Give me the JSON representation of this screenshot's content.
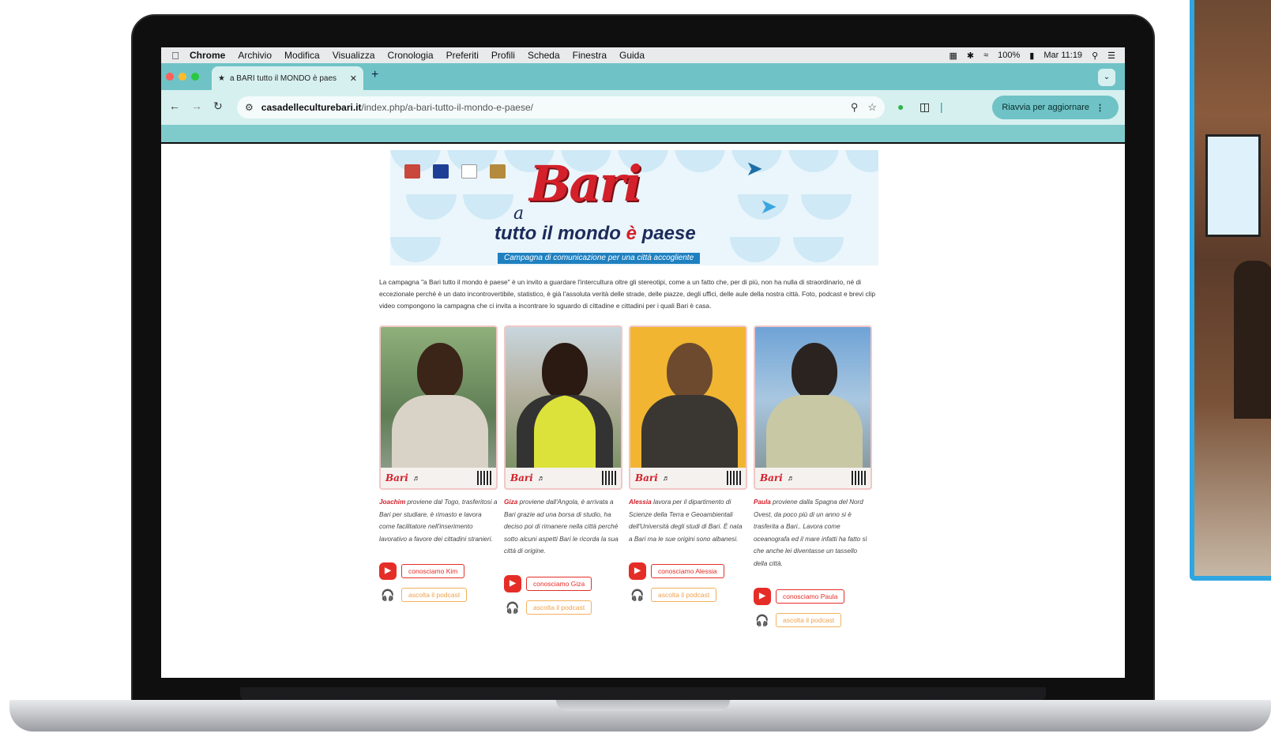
{
  "menubar": {
    "items": [
      "Chrome",
      "Archivio",
      "Modifica",
      "Visualizza",
      "Cronologia",
      "Preferiti",
      "Profili",
      "Scheda",
      "Finestra",
      "Guida"
    ],
    "battery": "100%",
    "clock": "Mar 11:19"
  },
  "browser": {
    "tab_title": "a BARI tutto il MONDO è paes",
    "url_host": "casadelleculturebari.it",
    "url_path": "/index.php/a-bari-tutto-il-mondo-e-paese/",
    "relaunch_label": "Riavvia per aggiornare"
  },
  "banner": {
    "a": "a",
    "bari": "Bari",
    "subtitle_pre": "tutto il mondo ",
    "subtitle_e": "è",
    "subtitle_post": " paese",
    "stripe": "Campagna di comunicazione per una città accogliente"
  },
  "intro": "La campagna \"a Bari tutto il mondo è paese\" è un invito a guardare l'intercultura oltre gli stereotipi, come a un fatto che, per di più, non ha nulla di straordinario, né di eccezionale perché è un dato incontrovertibile, statistico, è già l'assoluta verità delle strade, delle piazze, degli uffici, delle aule della nostra città. Foto, podcast e brevi clip video compongono la campagna che ci invita a incontrare lo sguardo di cittadine e cittadini per i quali Bari è casa.",
  "cards": [
    {
      "name": "Joachim",
      "text": " proviene dal Togo, trasferitosi a Bari per studiare, è rimasto e lavora come facilitatore nell'inserimento lavorativo a favore dei cittadini stranieri.",
      "video_label": "conosciamo Kim",
      "podcast_label": "ascolta il podcast"
    },
    {
      "name": "Giza",
      "text": " proviene dall'Angola, è arrivata a Bari grazie ad una borsa di studio, ha deciso poi di rimanere nella città perché sotto alcuni aspetti Bari le ricorda la sua città di origine.",
      "video_label": "conosciamo Giza",
      "podcast_label": "ascolta il podcast"
    },
    {
      "name": "Alessia",
      "text": " lavora per il dipartimento di Scienze della Terra e Geoambientali dell'Università degli studi di Bari. È nata a Bari ma le sue origini sono albanesi.",
      "video_label": "conosciamo Alessia",
      "podcast_label": "ascolta il podcast"
    },
    {
      "name": "Paula",
      "text": " proviene dalla Spagna del Nord Ovest, da poco più di un anno si è trasferita a Bari.. Lavora come oceanografa ed il mare infatti ha fatto sì che anche lei diventasse un tassello della città.",
      "video_label": "conosciamo Paula",
      "podcast_label": "ascolta il podcast"
    }
  ],
  "colors": {
    "tab_strip": "#6fc3c6",
    "toolbar": "#d6f0ef",
    "accent_red": "#d3202a",
    "side_frame": "#2fa6e0"
  }
}
